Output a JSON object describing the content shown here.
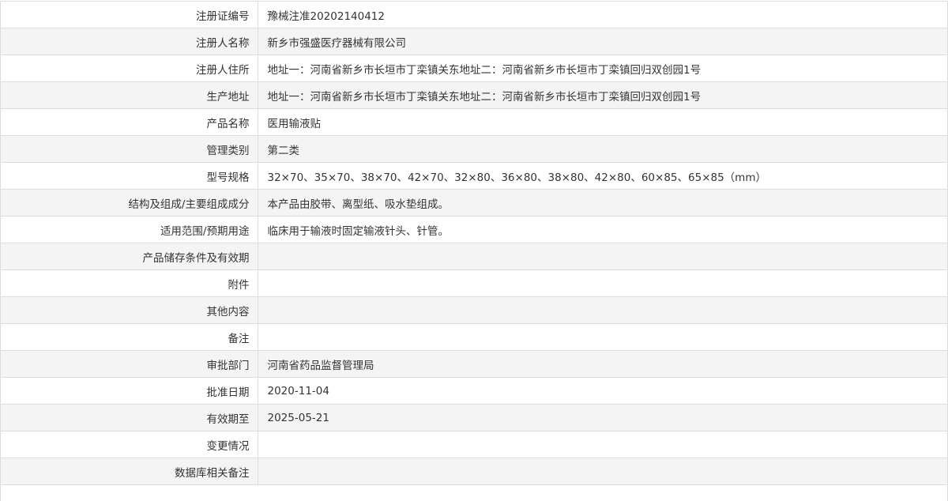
{
  "rows": [
    {
      "label": "注册证编号",
      "value": "豫械注准20202140412"
    },
    {
      "label": "注册人名称",
      "value": "新乡市强盛医疗器械有限公司"
    },
    {
      "label": "注册人住所",
      "value": "地址一：河南省新乡市长垣市丁栾镇关东地址二：河南省新乡市长垣市丁栾镇回归双创园1号"
    },
    {
      "label": "生产地址",
      "value": "地址一：河南省新乡市长垣市丁栾镇关东地址二：河南省新乡市长垣市丁栾镇回归双创园1号"
    },
    {
      "label": "产品名称",
      "value": "医用输液贴"
    },
    {
      "label": "管理类别",
      "value": "第二类"
    },
    {
      "label": "型号规格",
      "value": "32×70、35×70、38×70、42×70、32×80、36×80、38×80、42×80、60×85、65×85（mm）"
    },
    {
      "label": "结构及组成/主要组成成分",
      "value": "本产品由胶带、离型纸、吸水垫组成。"
    },
    {
      "label": "适用范围/预期用途",
      "value": "临床用于输液时固定输液针头、针管。"
    },
    {
      "label": "产品储存条件及有效期",
      "value": ""
    },
    {
      "label": "附件",
      "value": ""
    },
    {
      "label": "其他内容",
      "value": ""
    },
    {
      "label": "备注",
      "value": ""
    },
    {
      "label": "审批部门",
      "value": "河南省药品监督管理局"
    },
    {
      "label": "批准日期",
      "value": "2020-11-04"
    },
    {
      "label": "有效期至",
      "value": "2025-05-21"
    },
    {
      "label": "变更情况",
      "value": ""
    },
    {
      "label": "数据库相关备注",
      "value": ""
    }
  ]
}
